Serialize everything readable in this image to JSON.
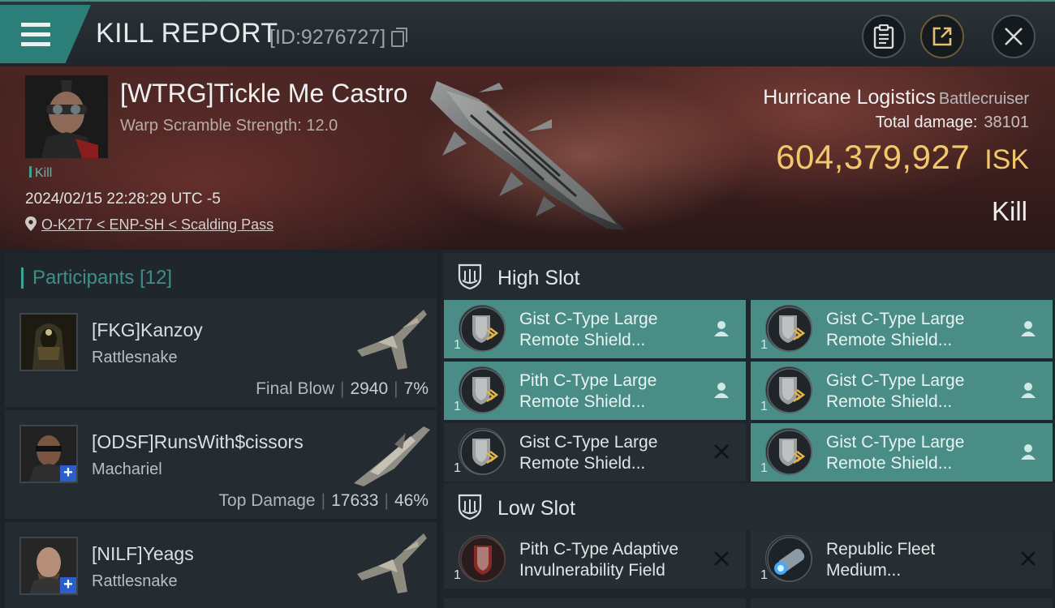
{
  "header": {
    "title": "KILL REPORT",
    "report_id": "[ID:9276727]"
  },
  "victim": {
    "pilot_name": "[WTRG]Tickle Me Castro",
    "subtitle": "Warp Scramble Strength: 12.0",
    "kill_tag": "Kill",
    "timestamp": "2024/02/15 22:28:29 UTC -5",
    "location": "O-K2T7 < ENP-SH < Scalding Pass",
    "ship_name": "Hurricane Logistics",
    "ship_class": "Battlecruiser",
    "total_damage_label": "Total damage:",
    "total_damage": "38101",
    "isk_value": "604,379,927",
    "isk_unit": "ISK",
    "result": "Kill"
  },
  "participants": {
    "label": "Participants",
    "count": "[12]",
    "items": [
      {
        "name": "[FKG]Kanzoy",
        "ship": "Rattlesnake",
        "tag": "Final Blow",
        "damage": "2940",
        "percent": "7%"
      },
      {
        "name": "[ODSF]RunsWith$cissors",
        "ship": "Machariel",
        "tag": "Top Damage",
        "damage": "17633",
        "percent": "46%"
      },
      {
        "name": "[NILF]Yeags",
        "ship": "Rattlesnake",
        "tag": "",
        "damage": "",
        "percent": ""
      }
    ]
  },
  "slots": {
    "high": {
      "label": "High Slot",
      "modules": [
        {
          "line1": "Gist C-Type Large",
          "line2": "Remote Shield...",
          "qty": "1",
          "status": "dropped"
        },
        {
          "line1": "Gist C-Type Large",
          "line2": "Remote Shield...",
          "qty": "1",
          "status": "dropped"
        },
        {
          "line1": "Pith C-Type Large",
          "line2": "Remote Shield...",
          "qty": "1",
          "status": "dropped"
        },
        {
          "line1": "Gist C-Type Large",
          "line2": "Remote Shield...",
          "qty": "1",
          "status": "dropped"
        },
        {
          "line1": "Gist C-Type Large",
          "line2": "Remote Shield...",
          "qty": "1",
          "status": "destroyed"
        },
        {
          "line1": "Gist C-Type Large",
          "line2": "Remote Shield...",
          "qty": "1",
          "status": "dropped"
        }
      ]
    },
    "low": {
      "label": "Low Slot",
      "modules": [
        {
          "line1": "Pith C-Type Adaptive",
          "line2": "Invulnerability Field",
          "qty": "1",
          "status": "destroyed"
        },
        {
          "line1": "Republic Fleet",
          "line2": "Medium...",
          "qty": "1",
          "status": "destroyed"
        }
      ]
    }
  },
  "colors": {
    "accent_teal": "#3fa395",
    "active_module": "#4a8d86",
    "isk_gold": "#f2c86a"
  }
}
